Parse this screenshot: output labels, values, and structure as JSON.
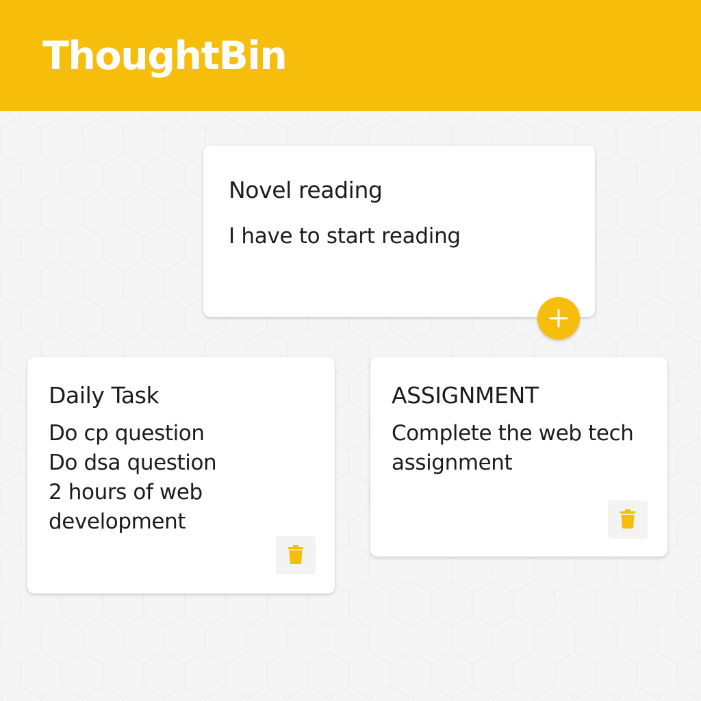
{
  "app": {
    "title": "ThoughtBin"
  },
  "colors": {
    "accent": "#f7bd0b",
    "background": "#f5f5f5",
    "card": "#ffffff",
    "text": "#1c1c1c"
  },
  "composer": {
    "title": "Novel reading",
    "content": "I have to start reading",
    "add_icon": "plus-icon"
  },
  "notes": [
    {
      "title": "Daily Task",
      "content": "Do cp question\nDo dsa question\n2 hours of web\ndevelopment",
      "delete_icon": "trash-icon"
    },
    {
      "title": "ASSIGNMENT",
      "content": "Complete the web tech\nassignment",
      "delete_icon": "trash-icon"
    }
  ]
}
